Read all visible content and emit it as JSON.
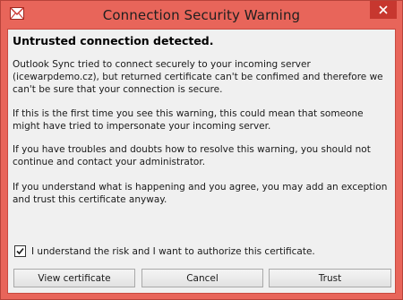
{
  "window": {
    "title": "Connection Security Warning",
    "app_icon": "envelope-icon",
    "close_icon": "close-icon",
    "accent_color": "#e8655a",
    "close_color": "#c7372f"
  },
  "message": {
    "heading": "Untrusted connection detected.",
    "paragraph_1": "Outlook Sync tried to connect securely to your incoming server (icewarpdemo.cz), but returned certificate can't be confimed and therefore we can't be sure that your connection is secure.",
    "paragraph_2": "If this is the first time you see this warning, this could mean that someone might have tried to impersonate your incoming server.",
    "paragraph_3": "If you have troubles and doubts how to resolve this warning, you should not continue and contact your administrator.",
    "paragraph_4": "If you understand what is happening and you agree, you may add an exception and trust this certificate anyway."
  },
  "consent": {
    "checked": true,
    "label": "I understand the risk and I want to authorize this certificate."
  },
  "buttons": {
    "view_certificate": "View certificate",
    "cancel": "Cancel",
    "trust": "Trust"
  }
}
